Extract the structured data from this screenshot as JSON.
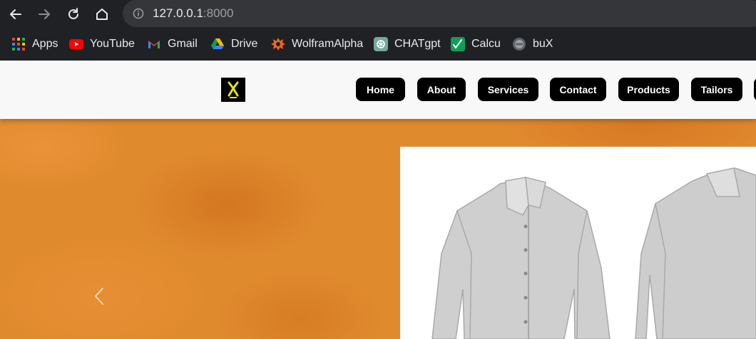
{
  "browser": {
    "url_host": "127.0.0.1",
    "url_port": ":8000",
    "icons": [
      "back-icon",
      "forward-icon",
      "reload-icon",
      "home-icon",
      "info-icon"
    ],
    "bookmarks": [
      {
        "label": "Apps",
        "icon": "apps-grid-icon"
      },
      {
        "label": "YouTube",
        "icon": "youtube-icon"
      },
      {
        "label": "Gmail",
        "icon": "gmail-icon"
      },
      {
        "label": "Drive",
        "icon": "drive-icon"
      },
      {
        "label": "WolframAlpha",
        "icon": "wolframalpha-icon"
      },
      {
        "label": "CHATgpt",
        "icon": "chatgpt-icon"
      },
      {
        "label": "Calcu",
        "icon": "calculator-icon"
      },
      {
        "label": "buX",
        "icon": "bux-icon"
      }
    ]
  },
  "site": {
    "nav": [
      "Home",
      "About",
      "Services",
      "Contact",
      "Products",
      "Tailors"
    ],
    "colors": {
      "header_bg": "#f8f8f8",
      "button_bg": "#000000",
      "hero_bg": "#e08a2e"
    }
  },
  "hero": {
    "image": "shirts-image",
    "prev_control": "chevron-left-icon"
  }
}
